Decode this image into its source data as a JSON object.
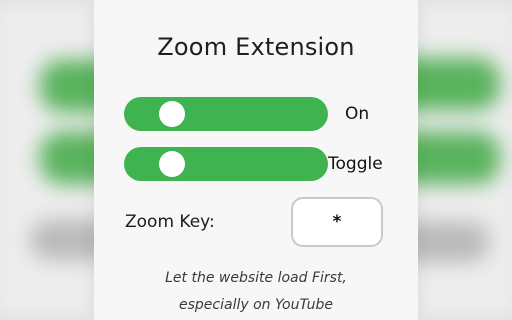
{
  "popup": {
    "title": "Zoom Extension",
    "switches": [
      {
        "label": "On",
        "enabled": true
      },
      {
        "label": "Toggle",
        "enabled": true
      }
    ],
    "zoom_key": {
      "label": "Zoom Key:",
      "value": "*"
    },
    "note_lines": [
      "Let the website load First,",
      "especially on YouTube"
    ]
  },
  "colors": {
    "switch_on": "#3fb34f",
    "background": "#f7f7f7"
  }
}
